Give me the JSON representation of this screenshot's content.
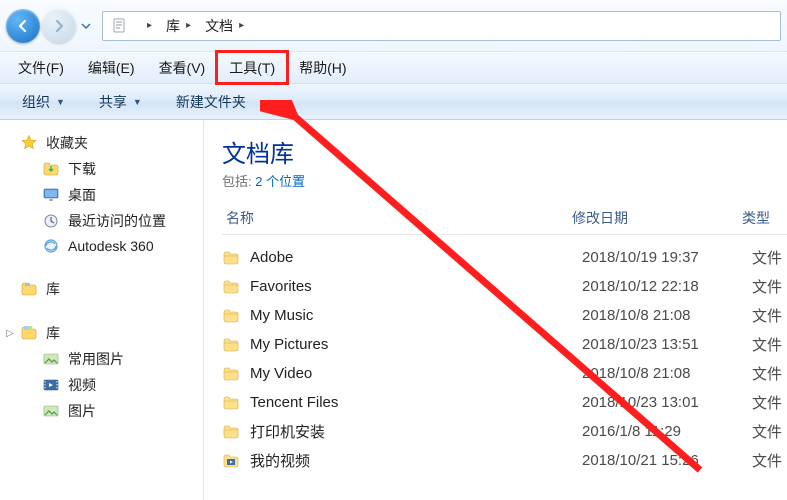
{
  "nav": {
    "back_enabled": true,
    "forward_enabled": false
  },
  "breadcrumb": {
    "root": "库",
    "current": "文档"
  },
  "menubar": {
    "items": [
      {
        "label": "文件(F)"
      },
      {
        "label": "编辑(E)"
      },
      {
        "label": "查看(V)"
      },
      {
        "label": "工具(T)",
        "highlighted": true
      },
      {
        "label": "帮助(H)"
      }
    ]
  },
  "toolbar": {
    "organize": "组织",
    "share": "共享",
    "new_folder": "新建文件夹"
  },
  "sidebar": {
    "favorites": {
      "label": "收藏夹",
      "items": [
        {
          "icon": "download-icon",
          "label": "下载"
        },
        {
          "icon": "desktop-icon",
          "label": "桌面"
        },
        {
          "icon": "recent-icon",
          "label": "最近访问的位置"
        },
        {
          "icon": "autodesk-icon",
          "label": "Autodesk 360"
        }
      ]
    },
    "libraries_single": {
      "label": "库"
    },
    "libraries_group": {
      "label": "库",
      "items": [
        {
          "icon": "pictures-icon",
          "label": "常用图片"
        },
        {
          "icon": "videos-icon",
          "label": "视频"
        },
        {
          "icon": "pictures2-icon",
          "label": "图片"
        }
      ]
    }
  },
  "content": {
    "title": "文档库",
    "include_prefix": "包括:",
    "include_link": "2 个位置",
    "columns": {
      "name": "名称",
      "date": "修改日期",
      "type": "类型"
    },
    "files": [
      {
        "icon": "folder-icon",
        "name": "Adobe",
        "date": "2018/10/19 19:37",
        "type": "文件"
      },
      {
        "icon": "folder-icon",
        "name": "Favorites",
        "date": "2018/10/12 22:18",
        "type": "文件"
      },
      {
        "icon": "folder-icon",
        "name": "My Music",
        "date": "2018/10/8 21:08",
        "type": "文件"
      },
      {
        "icon": "folder-icon",
        "name": "My Pictures",
        "date": "2018/10/23 13:51",
        "type": "文件"
      },
      {
        "icon": "folder-icon",
        "name": "My Video",
        "date": "2018/10/8 21:08",
        "type": "文件"
      },
      {
        "icon": "folder-icon",
        "name": "Tencent Files",
        "date": "2018/10/23 13:01",
        "type": "文件"
      },
      {
        "icon": "folder-icon",
        "name": "打印机安装",
        "date": "2016/1/8 11:29",
        "type": "文件"
      },
      {
        "icon": "folder-video-icon",
        "name": "我的视频",
        "date": "2018/10/21 15:26",
        "type": "文件"
      }
    ]
  },
  "annotation": {
    "highlight_menu_index": 3,
    "arrow": true
  }
}
